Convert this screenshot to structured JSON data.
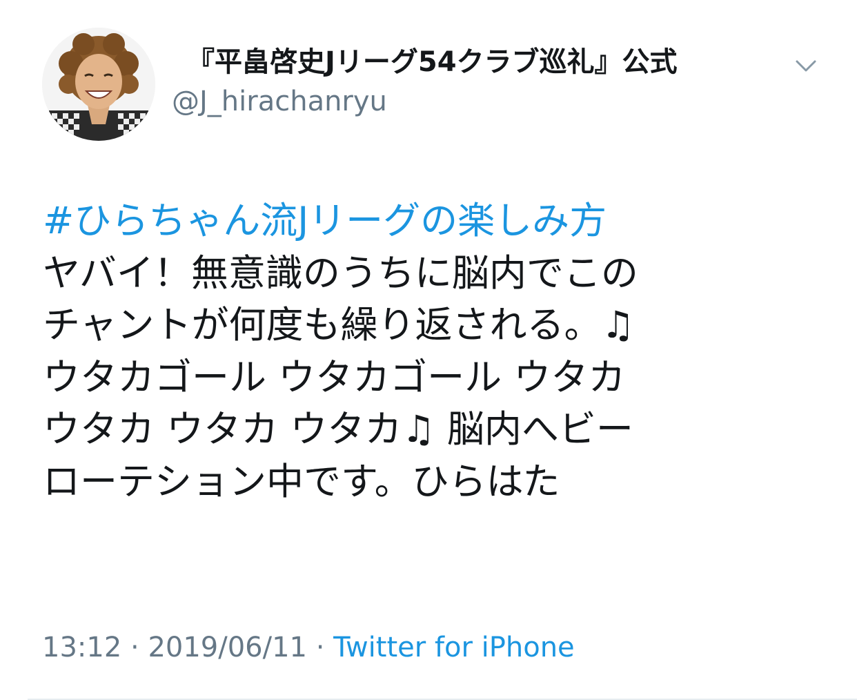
{
  "tweet": {
    "display_name": "『平畠啓史Jリーグ54クラブ巡礼』公式",
    "handle": "@J_hirachanryu",
    "hashtag": "#ひらちゃん流Jリーグの楽しみ方",
    "lines": [
      "ヤバイ！無意識のうちに脳内でこの",
      "チャントが何度も繰り返される。♫",
      "ウタカゴール ウタカゴール ウタカ",
      "ウタカ ウタカ ウタカ♫ 脳内へビー",
      "ローテション中です。ひらはた"
    ],
    "time": "13:12",
    "separator": " · ",
    "date": "2019/06/11",
    "source": "Twitter for iPhone"
  },
  "icons": {
    "menu": "chevron-down-icon",
    "avatar": "profile-photo"
  },
  "colors": {
    "text": "#14171a",
    "secondary": "#657786",
    "link": "#1b95e0",
    "divider": "#e6ecf0"
  }
}
